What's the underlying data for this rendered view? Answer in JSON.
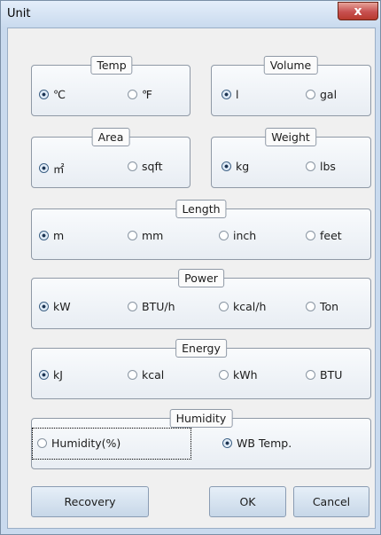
{
  "window": {
    "title": "Unit",
    "close_glyph": "x"
  },
  "groups": {
    "temp": {
      "title": "Temp",
      "options": [
        "℃",
        "℉"
      ],
      "selected_index": 0
    },
    "volume": {
      "title": "Volume",
      "options": [
        "l",
        "gal"
      ],
      "selected_index": 0
    },
    "area": {
      "title": "Area",
      "options": [
        "㎡",
        "sqft"
      ],
      "selected_index": 0
    },
    "weight": {
      "title": "Weight",
      "options": [
        "kg",
        "lbs"
      ],
      "selected_index": 0
    },
    "length": {
      "title": "Length",
      "options": [
        "m",
        "mm",
        "inch",
        "feet"
      ],
      "selected_index": 0
    },
    "power": {
      "title": "Power",
      "options": [
        "kW",
        "BTU/h",
        "kcal/h",
        "Ton"
      ],
      "selected_index": 0
    },
    "energy": {
      "title": "Energy",
      "options": [
        "kJ",
        "kcal",
        "kWh",
        "BTU"
      ],
      "selected_index": 0
    },
    "humidity": {
      "title": "Humidity",
      "options": [
        "Humidity(%)",
        "WB Temp."
      ],
      "selected_index": 1
    }
  },
  "buttons": {
    "recovery": "Recovery",
    "ok": "OK",
    "cancel": "Cancel"
  }
}
